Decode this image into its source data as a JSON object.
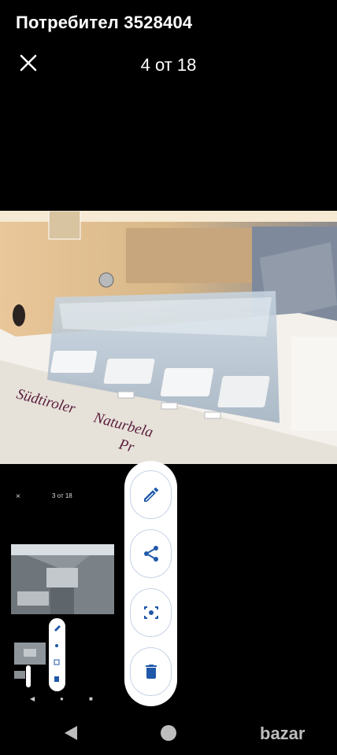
{
  "header": {
    "title": "Потребител 3528404",
    "counter": "4 от 18",
    "close_icon": "close-icon"
  },
  "photo": {
    "description_text": "Südtiroler Naturbela Pr",
    "sign_line1": "Südtiroler",
    "sign_line2": "Naturbela",
    "sign_line3": "Pr"
  },
  "thumbnail": {
    "close_label": "×",
    "counter": "3 от 18"
  },
  "actions": {
    "edit_icon": "pencil-icon",
    "share_icon": "share-icon",
    "screenshot_icon": "screen-capture-icon",
    "delete_icon": "trash-icon"
  },
  "navbar": {
    "back_icon": "back-triangle-icon",
    "home_icon": "home-circle-icon",
    "brand": "bazar"
  },
  "colors": {
    "accent": "#1f58a8",
    "pill_border": "#c7d3e6",
    "background": "#000000"
  }
}
